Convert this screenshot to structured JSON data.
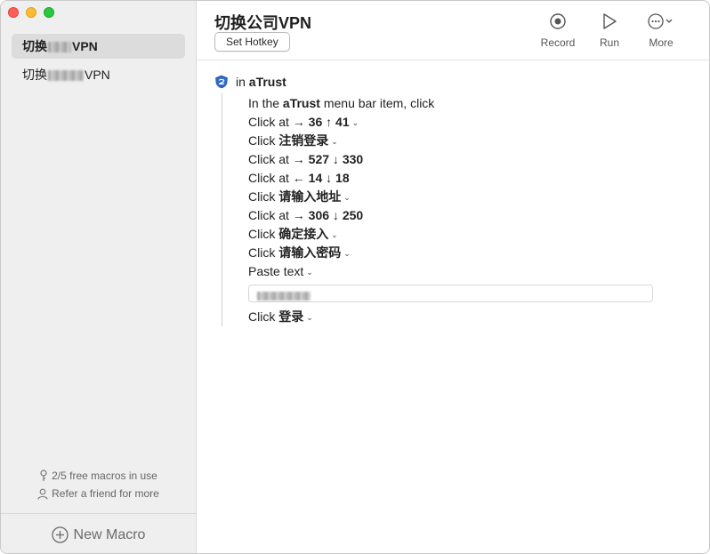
{
  "sidebar": {
    "macros": [
      {
        "prefix": "切换",
        "suffix": "VPN",
        "selected": true
      },
      {
        "prefix": "切换",
        "suffix": "VPN",
        "selected": false
      }
    ],
    "usage_text": "2/5 free macros in use",
    "referral_text": "Refer a friend for more",
    "new_macro_label": "New Macro"
  },
  "header": {
    "title": "切换公司VPN",
    "hotkey_label": "Set Hotkey",
    "tools": {
      "record": "Record",
      "run": "Run",
      "more": "More"
    }
  },
  "macro": {
    "app_prefix": "in",
    "app_name": "aTrust",
    "steps": [
      {
        "kind": "menubar",
        "text_a": "In the",
        "text_b": "aTrust",
        "text_c": "menu bar item, click"
      },
      {
        "kind": "click_at",
        "verb": "Click at",
        "coords": "→ 36 ↑ 41"
      },
      {
        "kind": "click",
        "verb": "Click",
        "target": "注销登录"
      },
      {
        "kind": "click_at",
        "verb": "Click at",
        "coords": "→ 527 ↓ 330"
      },
      {
        "kind": "click_at",
        "verb": "Click at",
        "coords": "← 14 ↓ 18"
      },
      {
        "kind": "click",
        "verb": "Click",
        "target": "请输入地址"
      },
      {
        "kind": "click_at",
        "verb": "Click at",
        "coords": "→ 306 ↓ 250"
      },
      {
        "kind": "click",
        "verb": "Click",
        "target": "确定接入"
      },
      {
        "kind": "click",
        "verb": "Click",
        "target": "请输入密码"
      },
      {
        "kind": "paste",
        "verb": "Paste text"
      },
      {
        "kind": "click",
        "verb": "Click",
        "target": "登录"
      }
    ]
  },
  "icons": {
    "record": "record-icon",
    "run": "play-icon",
    "more": "ellipsis-circle-icon",
    "app": "atrust-app-icon",
    "key": "key-icon",
    "person": "person-icon",
    "add": "plus-circle-icon"
  },
  "colors": {
    "close": "#fe5f57",
    "minimize": "#febc2e",
    "maximize": "#28c840",
    "sidebar_bg": "#efefef",
    "selected_bg": "#dcdcdc"
  }
}
